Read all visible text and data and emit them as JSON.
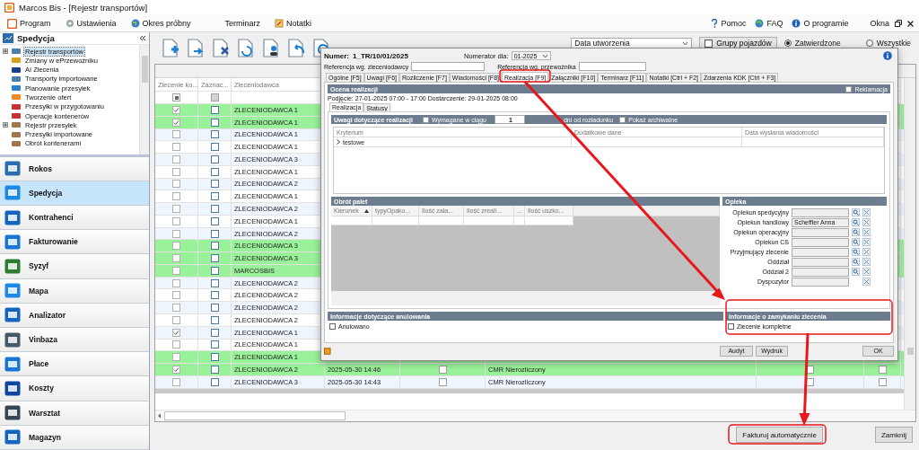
{
  "window": {
    "title": "Marcos Bis - [Rejestr transportów]"
  },
  "menu": {
    "left": [
      "Program",
      "Ustawienia",
      "Okres próbny",
      "Terminarz",
      "Notatki"
    ],
    "right": [
      "Pomoc",
      "FAQ",
      "O programie",
      "Okna"
    ]
  },
  "sidebar": {
    "title": "Spedycja",
    "tree": [
      {
        "label": "Rejestr transportów",
        "kind": "group",
        "selected": true
      },
      {
        "label": "Zmiany w ePrzewoźniku",
        "kind": "item",
        "selected": false
      },
      {
        "label": "AI Zlecenia",
        "kind": "item",
        "selected": false
      },
      {
        "label": "Transporty importowane",
        "kind": "item",
        "selected": false
      },
      {
        "label": "Planowanie przesyłek",
        "kind": "item",
        "selected": false
      },
      {
        "label": "Tworzenie ofert",
        "kind": "item",
        "selected": false
      },
      {
        "label": "Przesyłki w przygotowaniu",
        "kind": "item",
        "selected": false
      },
      {
        "label": "Operacje kontenerów",
        "kind": "item",
        "selected": false
      },
      {
        "label": "Rejestr przesyłek",
        "kind": "group",
        "selected": false
      },
      {
        "label": "Przesyłki importowane",
        "kind": "item",
        "selected": false
      },
      {
        "label": "Obrót kontenerami",
        "kind": "item",
        "selected": false
      }
    ],
    "modules": [
      {
        "label": "Rokos",
        "selected": false
      },
      {
        "label": "Spedycja",
        "selected": true
      },
      {
        "label": "Kontrahenci",
        "selected": false
      },
      {
        "label": "Fakturowanie",
        "selected": false
      },
      {
        "label": "Syzyf",
        "selected": false
      },
      {
        "label": "Mapa",
        "selected": false
      },
      {
        "label": "Analizator",
        "selected": false
      },
      {
        "label": "Vinbaza",
        "selected": false
      },
      {
        "label": "Płace",
        "selected": false
      },
      {
        "label": "Koszty",
        "selected": false
      },
      {
        "label": "Warsztat",
        "selected": false
      },
      {
        "label": "Magazyn",
        "selected": false
      }
    ]
  },
  "filters": {
    "sort_field": "Data utworzenia",
    "vehicle_groups": {
      "label": "Grupy pojazdów",
      "checked": false
    },
    "radios": [
      {
        "label": "Zatwierdzone",
        "selected": true
      },
      {
        "label": "Wszystkie",
        "selected": false
      }
    ]
  },
  "table": {
    "columns": [
      "Zlecenie ko...",
      "Zaznac...",
      "Zleceniodawca"
    ],
    "filter": [
      {
        "indeterminate": true,
        "disabled": false
      },
      {
        "indeterminate": false,
        "disabled": true
      }
    ],
    "rows": [
      {
        "done": true,
        "marked": false,
        "client": "ZLECENIODAWCA 1",
        "highlighted": true
      },
      {
        "done": true,
        "marked": false,
        "client": "ZLECENIODAWCA 1",
        "highlighted": true
      },
      {
        "done": false,
        "marked": false,
        "client": "ZLECENIODAWCA 1",
        "highlighted": false
      },
      {
        "done": false,
        "marked": false,
        "client": "ZLECENIODAWCA 1",
        "highlighted": false
      },
      {
        "done": false,
        "marked": false,
        "client": "ZLECENIODAWCA 3",
        "highlighted": false
      },
      {
        "done": false,
        "marked": false,
        "client": "ZLECENIODAWCA 1",
        "highlighted": false
      },
      {
        "done": false,
        "marked": false,
        "client": "ZLECENIODAWCA 2",
        "highlighted": false
      },
      {
        "done": false,
        "marked": false,
        "client": "ZLECENIODAWCA 1",
        "highlighted": false
      },
      {
        "done": false,
        "marked": false,
        "client": "ZLECENIODAWCA 2",
        "highlighted": false
      },
      {
        "done": false,
        "marked": false,
        "client": "ZLECENIODAWCA 1",
        "highlighted": false
      },
      {
        "done": false,
        "marked": false,
        "client": "ZLECENIODAWCA 2",
        "highlighted": false
      },
      {
        "done": false,
        "marked": false,
        "client": "ZLECENIODAWCA 3",
        "highlighted": true
      },
      {
        "done": false,
        "marked": false,
        "client": "ZLECENIODAWCA 3",
        "highlighted": true
      },
      {
        "done": false,
        "marked": false,
        "client": "MARCOSBIS",
        "highlighted": true
      },
      {
        "done": false,
        "marked": false,
        "client": "ZLECENIODAWCA 2",
        "highlighted": false
      },
      {
        "done": false,
        "marked": false,
        "client": "ZLECENIODAWCA 2",
        "highlighted": false
      },
      {
        "done": false,
        "marked": false,
        "client": "ZLECENIODAWCA 2",
        "highlighted": false
      },
      {
        "done": false,
        "marked": false,
        "client": "ZLECENIODAWCA 2",
        "highlighted": false
      },
      {
        "done": true,
        "marked": false,
        "client": "ZLECENIODAWCA 1",
        "highlighted": false
      },
      {
        "done": false,
        "marked": false,
        "client": "ZLECENIODAWCA 1",
        "highlighted": false
      },
      {
        "done": false,
        "marked": false,
        "client": "ZLECENIODAWCA 1",
        "highlighted": true
      },
      {
        "done": true,
        "marked": false,
        "client": "ZLECENIODAWCA 2",
        "highlighted": true,
        "created": "2025-05-30 14:46",
        "flag_a": false,
        "status": "CMR Nierozliczony",
        "flag_b": false,
        "flag_c": false
      },
      {
        "done": false,
        "marked": false,
        "client": "ZLECENIODAWCA 3",
        "highlighted": false,
        "created": "2025-05-30 14:43",
        "flag_a": false,
        "status": "CMR Nierozliczony",
        "flag_b": false,
        "flag_c": false
      }
    ]
  },
  "footer_buttons": [
    "Fakturuj automatycznie",
    "Zamknij"
  ],
  "dialog": {
    "number_label": "Numer:",
    "number": "1_TR/10/01/2025",
    "numerator_label": "Numerator dla:",
    "numerator": "01-2025",
    "client_ref_label": "Referencja wg. zleceniodawcy",
    "carrier_ref_label": "Referencja wg. przewoźnika",
    "tabs": [
      {
        "label": "Ogólne [F5]",
        "selected": false
      },
      {
        "label": "Uwagi [F6]",
        "selected": false
      },
      {
        "label": "Rozliczenie [F7]",
        "selected": false
      },
      {
        "label": "Wiadomości [F8]",
        "selected": false
      },
      {
        "label": "Realizacja [F9]",
        "selected": true
      },
      {
        "label": "Załączniki [F10]",
        "selected": false
      },
      {
        "label": "Terminarz [F11]",
        "selected": false
      },
      {
        "label": "Notatki [Ctrl + F2]",
        "selected": false
      },
      {
        "label": "Zdarzenia KDK [Ctrl + F3]",
        "selected": false
      }
    ],
    "evaluation": {
      "title": "Ocena realizacji",
      "complaint": {
        "label": "Reklamacja",
        "checked": false
      },
      "dates": "Podjęcie: 27-01-2025 07:00 - 17:00 Dostarczenie: 29-01-2025 08:00",
      "subtabs": [
        {
          "label": "Realizacja",
          "selected": true
        },
        {
          "label": "Statusy",
          "selected": false
        }
      ]
    },
    "remarks": {
      "title": "Uwagi dotyczące realizacji",
      "required": {
        "label": "Wymagane w ciągu",
        "checked": false
      },
      "days": "1",
      "days_label": "dni od rozładunku",
      "archived": {
        "label": "Pokaż archiwalne",
        "checked": false
      },
      "columns": [
        "Kryterium",
        "Dodatkowe dane",
        "Data wysłania wiadomości"
      ],
      "rows": [
        {
          "criterion": "testowe"
        }
      ]
    },
    "pallets": {
      "title": "Obrót palet",
      "columns": [
        "Kierunek",
        "typyOpako...",
        "Ilość zała...",
        "Ilość zreali...",
        "...",
        "Ilość uszko..."
      ]
    },
    "care": {
      "title": "Opieka",
      "fields": [
        {
          "label": "Opiekun spedycyjny",
          "search": true
        },
        {
          "label": "Opiekun handlowy",
          "value": "Scheffler Anna",
          "search": true
        },
        {
          "label": "Opiekun operacyjny",
          "search": true
        },
        {
          "label": "Opiekun CS",
          "search": true
        },
        {
          "label": "Przyjmujący zlecenie",
          "search": true
        },
        {
          "label": "Oddział",
          "search": true
        },
        {
          "label": "Oddział 2",
          "search": true
        },
        {
          "label": "Dyspozytor",
          "search": false
        }
      ]
    },
    "cancellation": {
      "title": "Informacje dotyczące anulowania",
      "cancelled": {
        "label": "Anulowano",
        "checked": false
      }
    },
    "closing": {
      "title": "Informacje o zamykaniu zlecenia",
      "complete": {
        "label": "Zlecenie kompletne",
        "checked": false
      }
    },
    "buttons": [
      "Audyt",
      "Wydruk",
      "OK"
    ]
  }
}
